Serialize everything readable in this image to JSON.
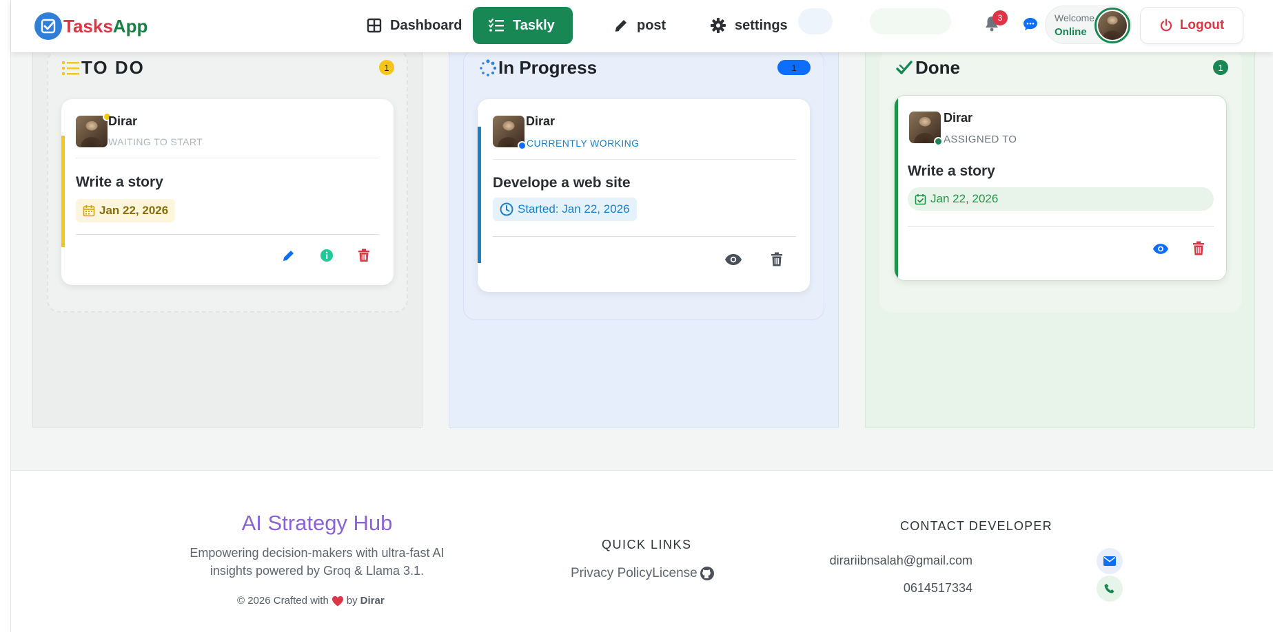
{
  "brand": {
    "name_part1": "Tasks",
    "name_part2": "App"
  },
  "nav": {
    "dashboard": "Dashboard",
    "taskly": "Taskly",
    "post": "post",
    "settings": "settings",
    "notifications_count": "3",
    "welcome": "Welcome",
    "status": "Online",
    "logout": "Logout"
  },
  "columns": [
    {
      "title": "TO DO",
      "count": "1",
      "accent": "#f5c518",
      "card": {
        "user": "Dirar",
        "status": "WAITING TO START",
        "task": "Write a story",
        "date": "Jan 22, 2026",
        "actions": [
          "edit-icon",
          "info-icon",
          "trash-icon"
        ]
      }
    },
    {
      "title": "In Progress",
      "count": "1",
      "accent": "#0d6efd",
      "card": {
        "user": "Dirar",
        "status": "CURRENTLY WORKING",
        "task": "Develope a web site",
        "date": "Started: Jan 22, 2026",
        "actions": [
          "eye-icon",
          "trash-icon"
        ]
      }
    },
    {
      "title": "Done",
      "count": "1",
      "accent": "#198754",
      "card": {
        "user": "Dirar",
        "status": "ASSIGNED TO",
        "task": "Write a story",
        "date": "Jan 22, 2026",
        "actions": [
          "eye-icon",
          "trash-icon"
        ]
      }
    }
  ],
  "footer": {
    "title": "AI Strategy Hub",
    "description": "Empowering decision-makers with ultra-fast AI insights powered by Groq & Llama 3.1.",
    "copyright_prefix": "© 2026 Crafted with",
    "copyright_by": "by",
    "author": "Dirar",
    "quick_links_heading": "QUICK LINKS",
    "links": [
      "Privacy Policy",
      "License"
    ],
    "contact_heading": "CONTACT DEVELOPER",
    "email": "dirariibnsalah@gmail.com",
    "phone": "0614517334"
  }
}
